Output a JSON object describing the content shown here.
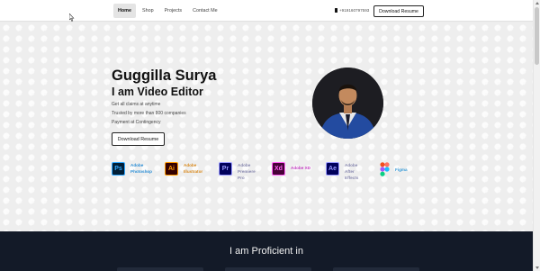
{
  "navbar": {
    "links": [
      {
        "label": "Home",
        "active": true
      },
      {
        "label": "Shop",
        "active": false
      },
      {
        "label": "Projects",
        "active": false
      },
      {
        "label": "Contact Me",
        "active": false
      }
    ],
    "phone": "+919160797593",
    "download_label": "Download Resume"
  },
  "hero": {
    "name": "Guggilla Surya",
    "role": "I am Video Editor",
    "lines": [
      "Get all claims at anytime",
      "Trusted by more than 800 companies",
      "Payment at Contingency"
    ],
    "button_label": "Download Resume"
  },
  "tools": [
    {
      "abbr": "Ps",
      "label": "Adobe Photoshop",
      "icon": "photoshop-icon",
      "bg": "#001e36",
      "fg": "#31a8ff",
      "label_color": "#2d8fd6"
    },
    {
      "abbr": "Ai",
      "label": "Adobe Illustrator",
      "icon": "illustrator-icon",
      "bg": "#330000",
      "fg": "#ff9a00",
      "label_color": "#d98a1e"
    },
    {
      "abbr": "Pr",
      "label": "Adobe Premiere Pro",
      "icon": "premiere-pro-icon",
      "bg": "#00005b",
      "fg": "#9999ff",
      "label_color": "#8a8ab0"
    },
    {
      "abbr": "Xd",
      "label": "Adobe XD",
      "icon": "xd-icon",
      "bg": "#470137",
      "fg": "#ff61f6",
      "label_color": "#c23bc0"
    },
    {
      "abbr": "Ae",
      "label": "Adobe After Effects",
      "icon": "after-effects-icon",
      "bg": "#00005b",
      "fg": "#9999ff",
      "label_color": "#8a8ab0"
    },
    {
      "abbr": "",
      "label": "Figma",
      "icon": "figma-icon",
      "bg": "transparent",
      "fg": "#f24e1e",
      "label_color": "#3a9cd8"
    }
  ],
  "section": {
    "title": "I am Proficient in"
  }
}
